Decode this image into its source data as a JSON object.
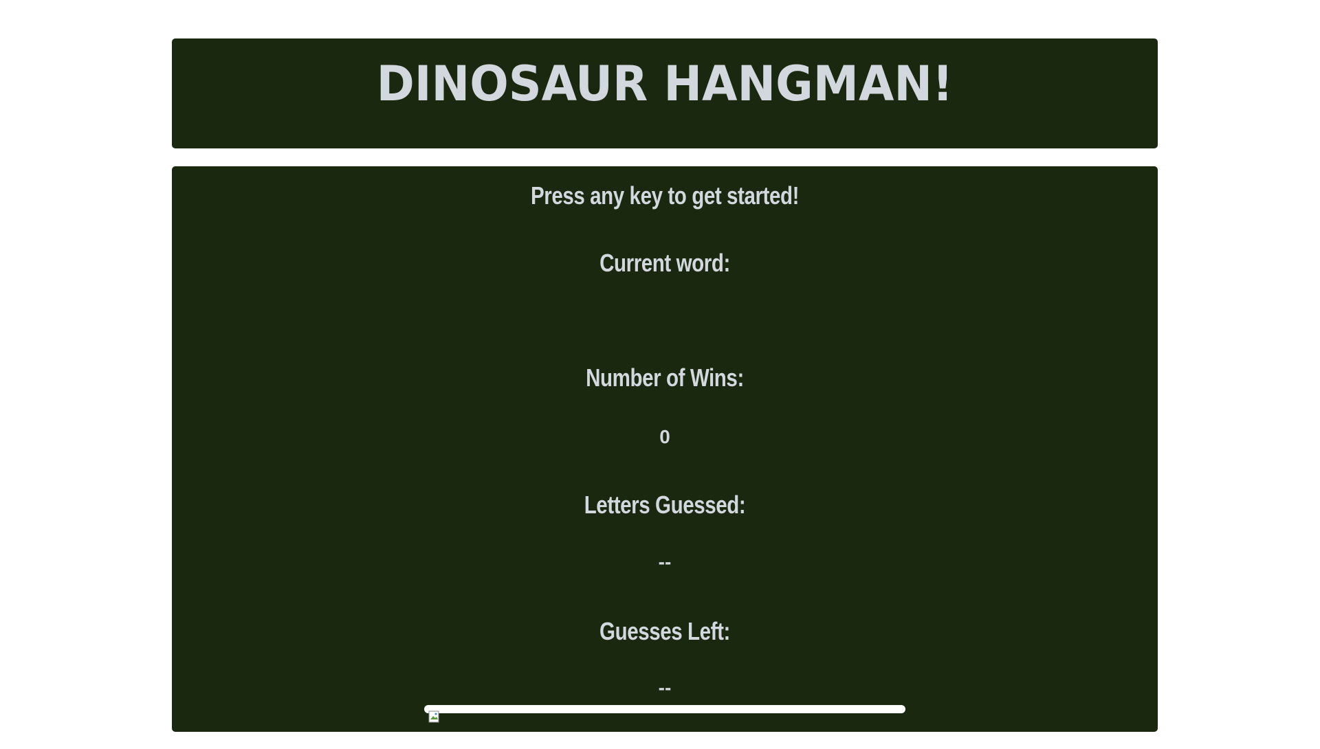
{
  "header": {
    "title": "DINOSAUR HANGMAN!"
  },
  "game": {
    "prompt": "Press any key to get started!",
    "current_word_label": "Current word:",
    "current_word_value": "",
    "wins_label": "Number of Wins:",
    "wins_value": "0",
    "letters_guessed_label": "Letters Guessed:",
    "letters_guessed_value": "--",
    "guesses_left_label": "Guesses Left:",
    "guesses_left_value": "--"
  },
  "colors": {
    "panel_bg": "#1b2810",
    "text": "#d3d7de",
    "page_bg": "#ffffff"
  },
  "icons": {
    "broken_image": "broken-image-icon"
  }
}
